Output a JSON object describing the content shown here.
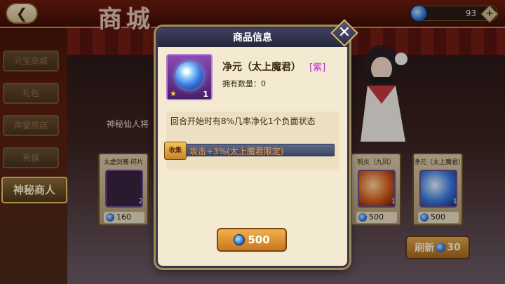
{
  "header": {
    "title": "商城",
    "currency": {
      "value": "93",
      "plus_label": "+"
    }
  },
  "side_tabs": [
    {
      "label": "元宝商城",
      "active": false
    },
    {
      "label": "礼包",
      "active": false
    },
    {
      "label": "声望商店",
      "active": false
    },
    {
      "label": "充值",
      "active": false
    },
    {
      "label": "神秘商人",
      "active": true
    }
  ],
  "shop": {
    "merchant_label": "神秘仙人将",
    "items": [
      {
        "name": "太虚剑魄·碎片",
        "price": "160",
        "count": "2"
      },
      {
        "name": "明炎（九凤）",
        "price": "500",
        "count": "1"
      },
      {
        "name": "净元（太上魔君）",
        "price": "500",
        "count": "1"
      }
    ],
    "refresh": {
      "label": "刷新",
      "cost": "30"
    }
  },
  "modal": {
    "title": "商品信息",
    "close_label": "✕",
    "item": {
      "name": "净元（太上魔君）",
      "rarity": "[紫]",
      "owned": "拥有数量：0",
      "quantity": "1",
      "star": "★"
    },
    "description": "回合开始时有8%几率净化1个负面状态",
    "bonus_tag": "收集",
    "bonus": "攻击+3%(太上魔君限定)",
    "buy_price": "500"
  },
  "colors": {
    "accent": "#f1b24c",
    "rarity_purple": "#b02ac8",
    "bonus_orange": "#ff9a3a"
  }
}
